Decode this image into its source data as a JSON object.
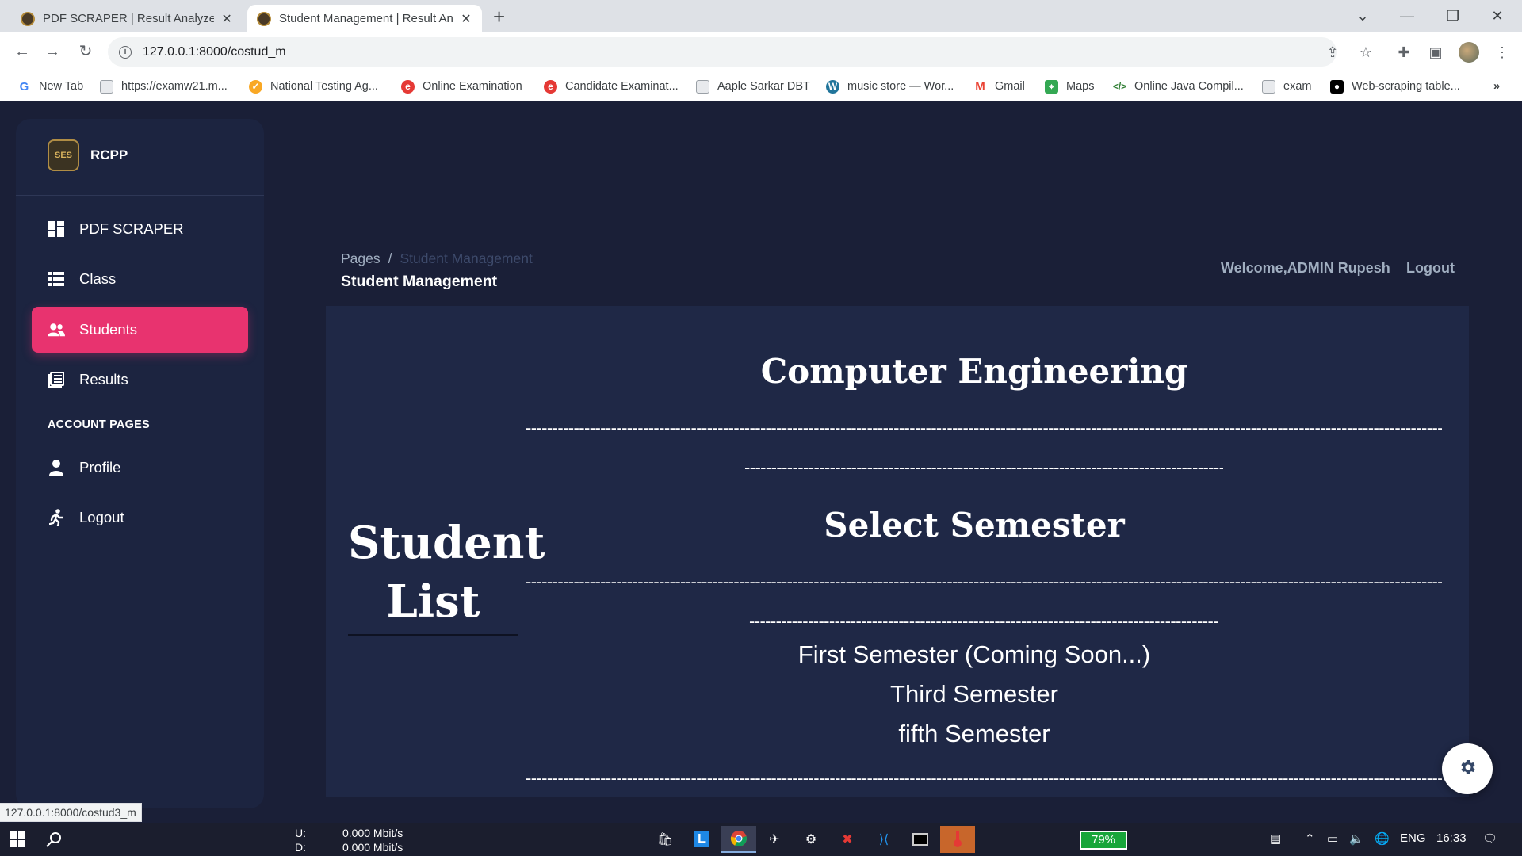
{
  "browser": {
    "tabs": [
      {
        "title": "PDF SCRAPER | Result Analyzer S"
      },
      {
        "title": "Student Management | Result An"
      }
    ],
    "url": "127.0.0.1:8000/costud_m",
    "bookmarks": [
      {
        "label": "New Tab",
        "icon": "google-icon",
        "color": "#4285f4"
      },
      {
        "label": "https://examw21.m...",
        "icon": "page-icon",
        "color": "#9aa0a6"
      },
      {
        "label": "National Testing Ag...",
        "icon": "nta-icon",
        "color": "#f9a825"
      },
      {
        "label": "Online Examination",
        "icon": "exam-icon",
        "color": "#e53935"
      },
      {
        "label": "Candidate Examinat...",
        "icon": "exam-icon",
        "color": "#e53935"
      },
      {
        "label": "Aaple Sarkar DBT",
        "icon": "page-icon",
        "color": "#9aa0a6"
      },
      {
        "label": "music store — Wor...",
        "icon": "wordpress-icon",
        "color": "#21759b"
      },
      {
        "label": "Gmail",
        "icon": "gmail-icon",
        "color": "#ea4335"
      },
      {
        "label": "Maps",
        "icon": "maps-icon",
        "color": "#34a853"
      },
      {
        "label": "Online Java Compil...",
        "icon": "code-icon",
        "color": "#2e7d32"
      },
      {
        "label": "exam",
        "icon": "page-icon",
        "color": "#9aa0a6"
      },
      {
        "label": "Web-scraping table...",
        "icon": "medium-icon",
        "color": "#000000"
      }
    ],
    "status_url": "127.0.0.1:8000/costud3_m"
  },
  "sidebar": {
    "brand": "RCPP",
    "logo_text": "SES",
    "items": [
      {
        "label": "PDF SCRAPER",
        "icon": "dashboard-icon",
        "active": false
      },
      {
        "label": "Class",
        "icon": "list-icon",
        "active": false
      },
      {
        "label": "Students",
        "icon": "users-icon",
        "active": true
      },
      {
        "label": "Results",
        "icon": "table-icon",
        "active": false
      }
    ],
    "section_title": "ACCOUNT PAGES",
    "account_items": [
      {
        "label": "Profile",
        "icon": "user-icon"
      },
      {
        "label": "Logout",
        "icon": "running-icon"
      }
    ]
  },
  "header": {
    "breadcrumb_root": "Pages",
    "breadcrumb_separator": "/",
    "breadcrumb_current": "Student Management",
    "title": "Student Management",
    "welcome": "Welcome,ADMIN Rupesh",
    "logout": "Logout"
  },
  "main": {
    "side_title": "Student List",
    "department": "Computer Engineering",
    "select_title": "Select Semester",
    "semesters": [
      "First Semester (Coming Soon...)",
      "Third Semester",
      "fifth Semester"
    ]
  },
  "taskbar": {
    "net_up_label": "U:",
    "net_up": "0.000 Mbit/s",
    "net_down_label": "D:",
    "net_down": "0.000 Mbit/s",
    "battery": "79%",
    "language": "ENG",
    "time": "16:33"
  },
  "colors": {
    "accent": "#e8336f",
    "background": "#1a1f37",
    "sidebar": "#1c2440",
    "card": "#1f2846"
  }
}
